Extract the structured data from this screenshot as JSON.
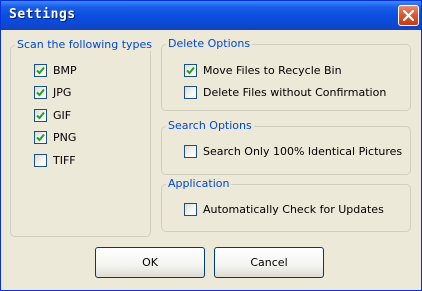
{
  "window": {
    "title": "Settings"
  },
  "scan_group": {
    "legend": "Scan the following types",
    "items": [
      {
        "label": "BMP",
        "checked": true
      },
      {
        "label": "JPG",
        "checked": true
      },
      {
        "label": "GIF",
        "checked": true
      },
      {
        "label": "PNG",
        "checked": true
      },
      {
        "label": "TIFF",
        "checked": false
      }
    ]
  },
  "delete_group": {
    "legend": "Delete Options",
    "items": [
      {
        "label": "Move Files to Recycle Bin",
        "checked": true
      },
      {
        "label": "Delete Files without Confirmation",
        "checked": false
      }
    ]
  },
  "search_group": {
    "legend": "Search Options",
    "items": [
      {
        "label": "Search Only 100% Identical Pictures",
        "checked": false
      }
    ]
  },
  "app_group": {
    "legend": "Application",
    "items": [
      {
        "label": "Automatically Check for Updates",
        "checked": false
      }
    ]
  },
  "buttons": {
    "ok": "OK",
    "cancel": "Cancel"
  },
  "colors": {
    "titlebar": "#0a4fe0",
    "legend_text": "#0046d5",
    "checkmark": "#21a121",
    "close_button": "#d9572d"
  },
  "icons": {
    "close": "close-icon",
    "check": "checkmark-icon"
  }
}
